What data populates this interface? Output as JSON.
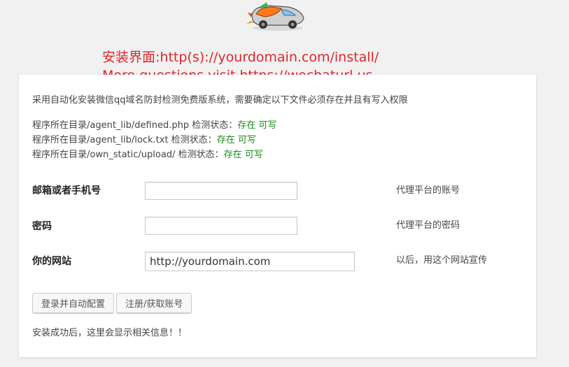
{
  "header": {
    "logo_icon": "rocket-car-logo",
    "install_note": "安装界面:http(s)://yourdomain.com/install/",
    "more_note": "More questions,visit https://wechaturl.us",
    "note_color": "#e0262b"
  },
  "intro": "采用自动化安装微信qq域名防封检测免费版系统，需要确定以下文件必须存在并且有写入权限",
  "checks": [
    {
      "prefix": "程序所在目录/agent_lib/defined.php 检测状态：",
      "status": "存在 可写"
    },
    {
      "prefix": "程序所在目录/agent_lib/lock.txt 检测状态：",
      "status": "存在 可写"
    },
    {
      "prefix": "程序所在目录/own_static/upload/ 检测状态：",
      "status": "存在 可写"
    }
  ],
  "status_color": "#1a8a1a",
  "form": {
    "account": {
      "label": "邮箱或者手机号",
      "value": "",
      "hint": "代理平台的账号"
    },
    "password": {
      "label": "密码",
      "value": "",
      "hint": "代理平台的密码"
    },
    "website": {
      "label": "你的网站",
      "value": "http://yourdomain.com",
      "hint": "以后，用这个网站宣传"
    }
  },
  "buttons": {
    "login": "登录并自动配置",
    "register": "注册/获取账号"
  },
  "footer_msg": "安装成功后，这里会显示相关信息！！"
}
